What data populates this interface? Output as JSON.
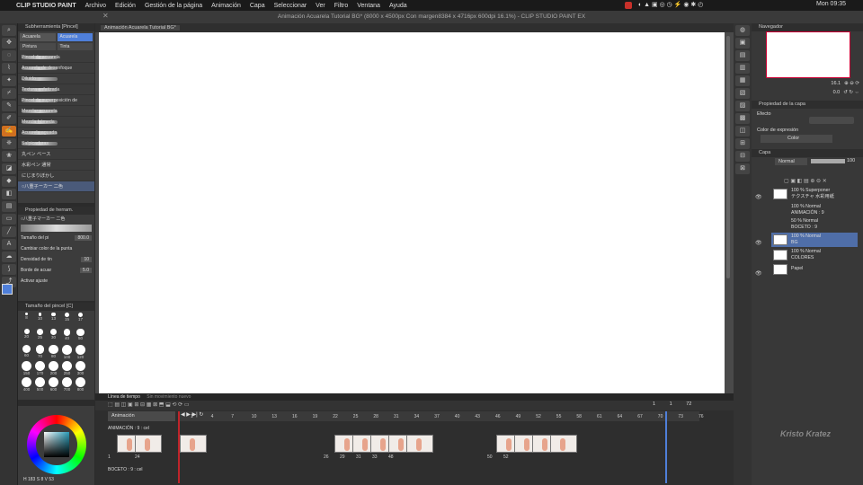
{
  "menubar": {
    "app": "CLIP STUDIO PAINT",
    "items": [
      "Archivo",
      "Edición",
      "Gestión de la página",
      "Animación",
      "Capa",
      "Seleccionar",
      "Ver",
      "Filtro",
      "Ventana",
      "Ayuda"
    ],
    "clock": "Mon 09:35"
  },
  "titlebar": {
    "title": "Animación Acuarela Tutorial BG* (8000 x 4500px Con margen8384 x 4716px 600dpi 16.1%) - CLIP STUDIO PAINT EX"
  },
  "canvas_tab": {
    "label": "Animación Acuarela Tutorial BG*"
  },
  "subtool": {
    "title": "Subherramienta [Pincel]",
    "tabs": [
      "Acuarela",
      "Acuarela"
    ],
    "subtabs": [
      "Pintura",
      "Tinta"
    ],
    "brushes": [
      "Pincel de acuarela",
      "Acuarela de desenfoque",
      "Diluido",
      "Textura enfatizada",
      "Pincel de superposición de",
      "Mezclar acuarela",
      "Mezcla húmeda",
      "Acuarela aguada",
      "Salpicaduras",
      "丸ペン ベース",
      "水彩ペン 通常",
      "にじまりぼかし",
      "○八重子ーカー 二色"
    ]
  },
  "tool_property": {
    "title": "Propiedad de herram.",
    "brush_name": "○八重子マーカー 二色",
    "brush_size_label": "Tamaño del pi",
    "brush_size_value": "800.0",
    "color_change_label": "Cambiar color de la punta",
    "density_label": "Densidad de tin",
    "density_value": "10",
    "edge_label": "Borde de acuar",
    "edge_value": "5.0",
    "snap_label": "Activar ajuste"
  },
  "brush_size_panel": {
    "title": "Tamaño del pincel [C]",
    "sizes": [
      "8",
      "10",
      "13",
      "15",
      "17",
      "20",
      "25",
      "30",
      "40",
      "50",
      "60",
      "70",
      "80",
      "100",
      "120",
      "150",
      "170",
      "200",
      "250",
      "300",
      "400",
      "500",
      "600",
      "700",
      "800"
    ]
  },
  "color_wheel": {
    "readout": "H 183 S 8  V 53",
    "hue_ring": "#e03030"
  },
  "navigator": {
    "title": "Navegador",
    "zoom": "16.1",
    "angle": "0.0"
  },
  "layer_property": {
    "title": "Propiedad de la capa",
    "effect_label": "Efecto",
    "expression_label": "Color de expresión",
    "expression_value": "Color"
  },
  "layers_panel": {
    "title": "Capa",
    "blend_mode": "Normal",
    "opacity": "100",
    "layers": [
      {
        "line1": "100 % Superponer",
        "line2": "テクスチャ 水彩用紙"
      },
      {
        "line1": "100 % Normal",
        "line2": "ANIMACIÓN : 9"
      },
      {
        "line1": "50 % Normal",
        "line2": "BOCETO : 9"
      },
      {
        "line1": "100 % Normal",
        "line2": "BG"
      },
      {
        "line1": "100 % Normal",
        "line2": "COLORES"
      },
      {
        "line1": "",
        "line2": "Papel"
      }
    ]
  },
  "timeline": {
    "title": "Línea de tiempo",
    "subtitle": "Sin movimiento nuevo",
    "track_name": "Animación",
    "frame_ruler": [
      "1",
      "4",
      "7",
      "10",
      "13",
      "16",
      "19",
      "22",
      "25",
      "28",
      "31",
      "34",
      "37",
      "40",
      "43",
      "46",
      "49",
      "52",
      "55",
      "58",
      "61",
      "64",
      "67",
      "70",
      "73",
      "76"
    ],
    "end_markers": [
      "1",
      "1",
      "72"
    ],
    "tracks": [
      {
        "name": "ANIMACIÓN : 9 : cel",
        "frame_numbers": [
          "1",
          "24",
          "26",
          "29",
          "31",
          "33",
          "48",
          "50",
          "52"
        ]
      },
      {
        "name": "BOCETO : 9 : cel"
      }
    ]
  },
  "watermark": "Kristo Kratez",
  "colors": {
    "accent": "#4f7fd9",
    "playhead": "#c0242a",
    "ui_bg": "#2b2b2b"
  }
}
